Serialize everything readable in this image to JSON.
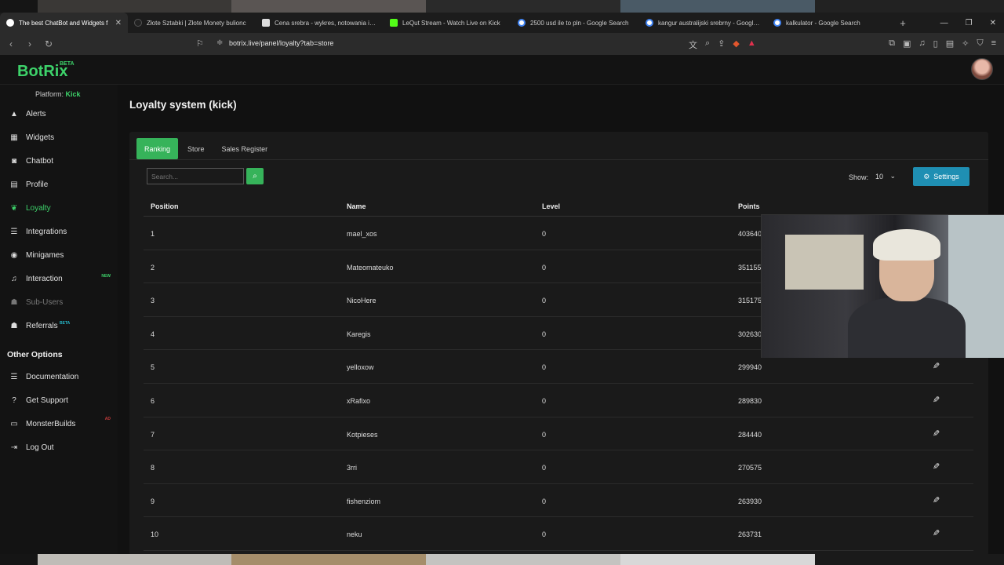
{
  "browser": {
    "tabs": [
      {
        "title": "The best ChatBot and Widgets f",
        "active": true,
        "icon": "botrix"
      },
      {
        "title": "Złote Sztabki | Złote Monety bulionc",
        "active": false,
        "icon": "site"
      },
      {
        "title": "Cena srebra - wykres, notowania i ku",
        "active": false,
        "icon": "site"
      },
      {
        "title": "LeQut Stream - Watch Live on Kick",
        "active": false,
        "icon": "kick"
      },
      {
        "title": "2500 usd ile to pln - Google Search",
        "active": false,
        "icon": "google"
      },
      {
        "title": "kangur australijski srebrny - Google S",
        "active": false,
        "icon": "google"
      },
      {
        "title": "kalkulator - Google Search",
        "active": false,
        "icon": "google"
      }
    ],
    "url": "botrix.live/panel/loyalty?tab=store"
  },
  "brand": {
    "name": "BotRix",
    "badge": "BETA",
    "accent": "#3dd26a"
  },
  "sidebar": {
    "platform_label": "Platform:",
    "platform_value": "Kick",
    "items": [
      {
        "label": "Alerts",
        "icon": "warning-icon"
      },
      {
        "label": "Widgets",
        "icon": "grid-icon"
      },
      {
        "label": "Chatbot",
        "icon": "robot-icon"
      },
      {
        "label": "Profile",
        "icon": "id-card-icon"
      },
      {
        "label": "Loyalty",
        "icon": "leaf-icon",
        "active": true
      },
      {
        "label": "Integrations",
        "icon": "list-icon"
      },
      {
        "label": "Minigames",
        "icon": "gamepad-icon"
      },
      {
        "label": "Interaction",
        "icon": "music-icon",
        "badge": "NEW"
      },
      {
        "label": "Sub-Users",
        "icon": "users-icon",
        "disabled": true
      },
      {
        "label": "Referrals",
        "icon": "users-icon",
        "badge": "BETA"
      }
    ],
    "other_title": "Other Options",
    "other_items": [
      {
        "label": "Documentation",
        "icon": "list-icon"
      },
      {
        "label": "Get Support",
        "icon": "question-icon"
      },
      {
        "label": "MonsterBuilds",
        "icon": "monitor-icon",
        "badge": "AD"
      },
      {
        "label": "Log Out",
        "icon": "logout-icon"
      }
    ]
  },
  "main": {
    "title": "Loyalty system (kick)",
    "tabs": [
      "Ranking",
      "Store",
      "Sales Register"
    ],
    "search_placeholder": "Search...",
    "show_label": "Show:",
    "show_value": "10",
    "settings_label": "Settings",
    "columns": [
      "Position",
      "Name",
      "Level",
      "Points"
    ],
    "rows": [
      {
        "position": "1",
        "name": "mael_xos",
        "level": "0",
        "points": "403640"
      },
      {
        "position": "2",
        "name": "Mateomateuko",
        "level": "0",
        "points": "351155"
      },
      {
        "position": "3",
        "name": "NicoHere",
        "level": "0",
        "points": "315175"
      },
      {
        "position": "4",
        "name": "Karegis",
        "level": "0",
        "points": "302630"
      },
      {
        "position": "5",
        "name": "yelloxow",
        "level": "0",
        "points": "299940"
      },
      {
        "position": "6",
        "name": "xRafixo",
        "level": "0",
        "points": "289830"
      },
      {
        "position": "7",
        "name": "Kotpieses",
        "level": "0",
        "points": "284440"
      },
      {
        "position": "8",
        "name": "3rri",
        "level": "0",
        "points": "270575"
      },
      {
        "position": "9",
        "name": "fishenziom",
        "level": "0",
        "points": "263930"
      },
      {
        "position": "10",
        "name": "neku",
        "level": "0",
        "points": "263731"
      }
    ]
  }
}
